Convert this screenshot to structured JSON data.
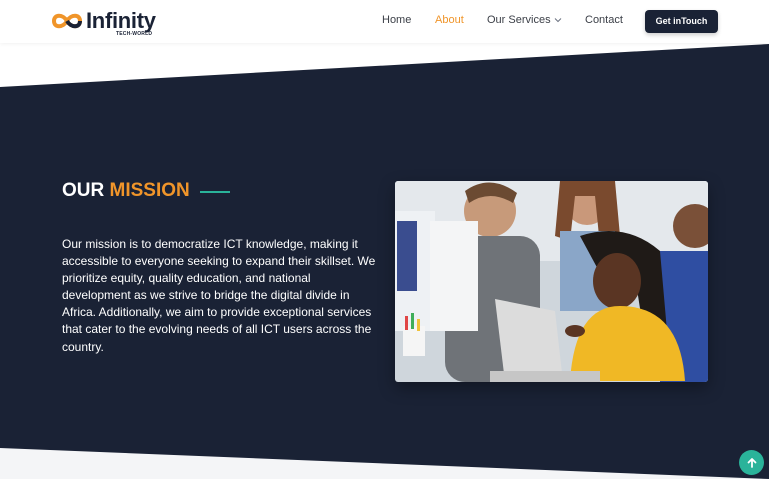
{
  "brand": {
    "name": "Infinity",
    "tagline": "TECH-WORLD",
    "colors": {
      "accent": "#f0952a",
      "dark": "#1a2235",
      "teal": "#2ab39a"
    }
  },
  "nav": {
    "items": [
      {
        "label": "Home",
        "active": false
      },
      {
        "label": "About",
        "active": true
      },
      {
        "label": "Our Services",
        "active": false,
        "has_dropdown": true
      },
      {
        "label": "Contact",
        "active": false
      }
    ],
    "cta_label": "Get inTouch"
  },
  "mission": {
    "title_prefix": "OUR",
    "title_accent": "MISSION",
    "body": "Our mission is to democratize ICT knowledge, making it accessible to everyone seeking to expand their skillset. We prioritize equity, quality education, and national development as we strive to bridge the digital divide in Africa. Additionally, we aim to provide exceptional services that cater to the evolving needs of all ICT users across the country."
  },
  "icons": {
    "dropdown": "chevron-down-icon",
    "scroll_top": "arrow-up-icon",
    "logo": "infinity-logo-icon"
  }
}
